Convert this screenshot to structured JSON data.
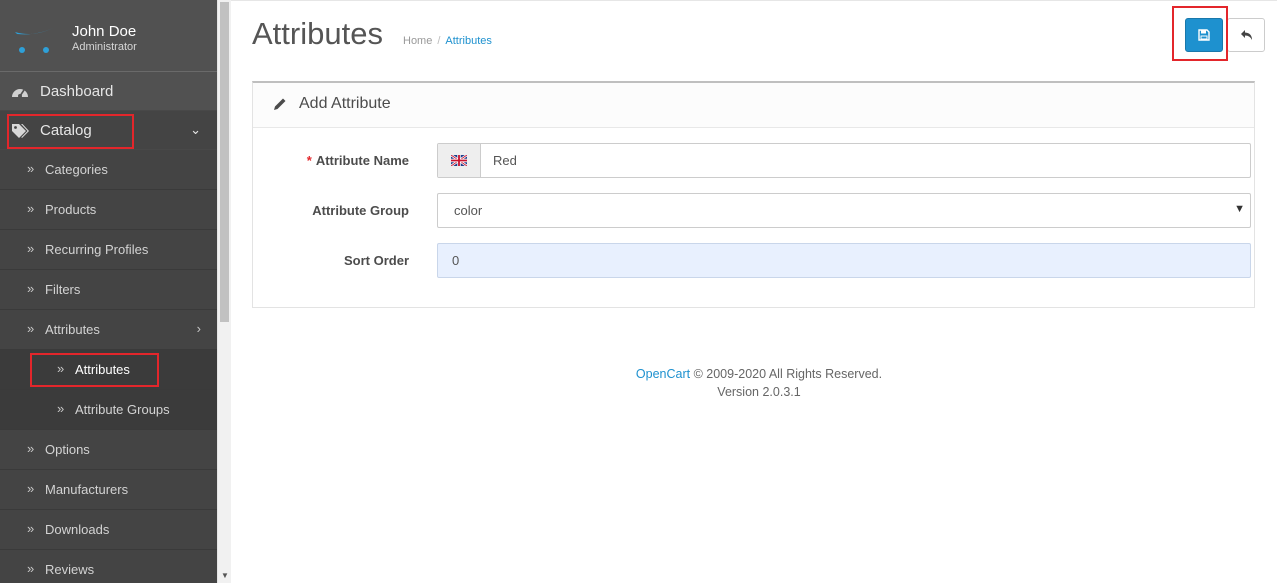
{
  "user": {
    "name": "John Doe",
    "role": "Administrator"
  },
  "nav": {
    "dashboard": "Dashboard",
    "catalog": "Catalog",
    "catalog_items": [
      {
        "label": "Categories"
      },
      {
        "label": "Products"
      },
      {
        "label": "Recurring Profiles"
      },
      {
        "label": "Filters"
      },
      {
        "label": "Attributes"
      }
    ],
    "attribute_children": [
      {
        "label": "Attributes"
      },
      {
        "label": "Attribute Groups"
      }
    ],
    "more_items": [
      {
        "label": "Options"
      },
      {
        "label": "Manufacturers"
      },
      {
        "label": "Downloads"
      },
      {
        "label": "Reviews"
      }
    ]
  },
  "page": {
    "title": "Attributes",
    "breadcrumb": [
      {
        "label": "Home"
      },
      {
        "label": "Attributes"
      }
    ],
    "breadcrumb_sep": "/"
  },
  "panel": {
    "title": "Add Attribute",
    "required_mark": "*",
    "fields": {
      "name": {
        "label": "Attribute Name",
        "value": "Red"
      },
      "group": {
        "label": "Attribute Group",
        "value": "color"
      },
      "sort": {
        "label": "Sort Order",
        "value": "0"
      }
    }
  },
  "footer": {
    "brand": "OpenCart",
    "rights": "© 2009-2020 All Rights Reserved.",
    "version": "Version 2.0.3.1"
  },
  "colors": {
    "sidebar": "#515151",
    "accent": "#1e91cf",
    "highlight": "#e3262b"
  }
}
